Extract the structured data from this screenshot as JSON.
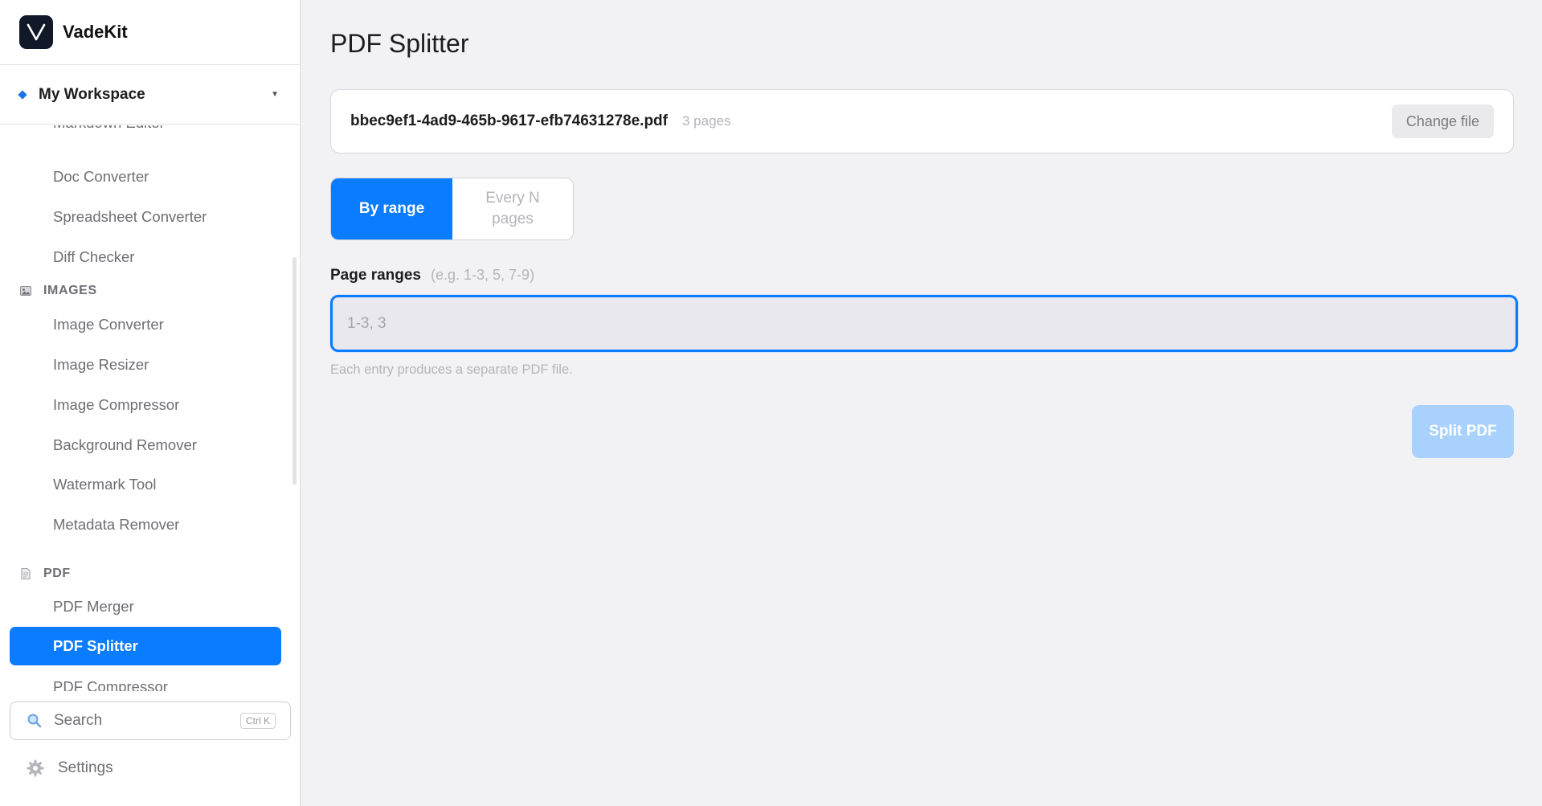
{
  "app": {
    "name": "VadeKit"
  },
  "workspace": {
    "label": "My Workspace"
  },
  "sidebar": {
    "items_top": [
      {
        "label": "Markdown Editor"
      },
      {
        "label": "Doc Converter"
      },
      {
        "label": "Spreadsheet Converter"
      },
      {
        "label": "Diff Checker"
      }
    ],
    "sections": [
      {
        "title": "IMAGES",
        "items": [
          {
            "label": "Image Converter"
          },
          {
            "label": "Image Resizer"
          },
          {
            "label": "Image Compressor"
          },
          {
            "label": "Background Remover"
          },
          {
            "label": "Watermark Tool"
          },
          {
            "label": "Metadata Remover"
          }
        ]
      },
      {
        "title": "PDF",
        "items": [
          {
            "label": "PDF Merger"
          },
          {
            "label": "PDF Splitter"
          },
          {
            "label": "PDF Compressor"
          }
        ]
      }
    ],
    "search": {
      "label": "Search",
      "shortcut": "Ctrl K"
    },
    "settings": {
      "label": "Settings"
    }
  },
  "main": {
    "title": "PDF Splitter",
    "file": {
      "name": "bbec9ef1-4ad9-465b-9617-efb74631278e.pdf",
      "pages": "3 pages",
      "change_label": "Change file"
    },
    "mode": {
      "options": [
        {
          "label": "By range"
        },
        {
          "label": "Every N pages"
        }
      ],
      "selected": "By range"
    },
    "ranges": {
      "label": "Page ranges",
      "hint": "(e.g. 1-3, 5, 7-9)",
      "value": "",
      "placeholder": "1-3, 3",
      "helper": "Each entry produces a separate PDF file."
    },
    "split_label": "Split PDF"
  },
  "colors": {
    "accent": "#0a7cff",
    "accent_disabled": "#a9d1fd",
    "sidebar_bg": "#ffffff",
    "main_bg": "#f2f2f5",
    "muted_text": "#6e6e73"
  }
}
